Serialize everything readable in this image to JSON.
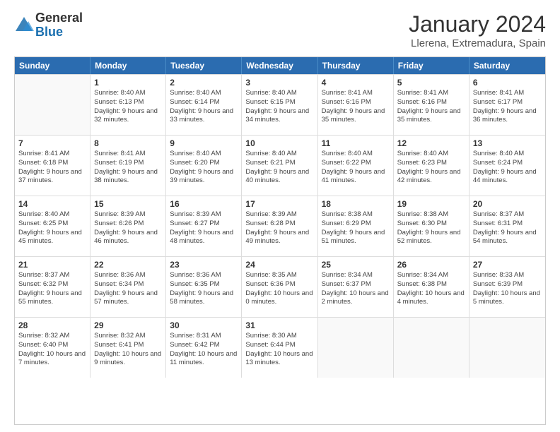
{
  "logo": {
    "general": "General",
    "blue": "Blue"
  },
  "title": "January 2024",
  "location": "Llerena, Extremadura, Spain",
  "header_days": [
    "Sunday",
    "Monday",
    "Tuesday",
    "Wednesday",
    "Thursday",
    "Friday",
    "Saturday"
  ],
  "weeks": [
    [
      {
        "day": "",
        "empty": true
      },
      {
        "day": "1",
        "sunrise": "Sunrise: 8:40 AM",
        "sunset": "Sunset: 6:13 PM",
        "daylight": "Daylight: 9 hours and 32 minutes."
      },
      {
        "day": "2",
        "sunrise": "Sunrise: 8:40 AM",
        "sunset": "Sunset: 6:14 PM",
        "daylight": "Daylight: 9 hours and 33 minutes."
      },
      {
        "day": "3",
        "sunrise": "Sunrise: 8:40 AM",
        "sunset": "Sunset: 6:15 PM",
        "daylight": "Daylight: 9 hours and 34 minutes."
      },
      {
        "day": "4",
        "sunrise": "Sunrise: 8:41 AM",
        "sunset": "Sunset: 6:16 PM",
        "daylight": "Daylight: 9 hours and 35 minutes."
      },
      {
        "day": "5",
        "sunrise": "Sunrise: 8:41 AM",
        "sunset": "Sunset: 6:16 PM",
        "daylight": "Daylight: 9 hours and 35 minutes."
      },
      {
        "day": "6",
        "sunrise": "Sunrise: 8:41 AM",
        "sunset": "Sunset: 6:17 PM",
        "daylight": "Daylight: 9 hours and 36 minutes."
      }
    ],
    [
      {
        "day": "7",
        "sunrise": "Sunrise: 8:41 AM",
        "sunset": "Sunset: 6:18 PM",
        "daylight": "Daylight: 9 hours and 37 minutes."
      },
      {
        "day": "8",
        "sunrise": "Sunrise: 8:41 AM",
        "sunset": "Sunset: 6:19 PM",
        "daylight": "Daylight: 9 hours and 38 minutes."
      },
      {
        "day": "9",
        "sunrise": "Sunrise: 8:40 AM",
        "sunset": "Sunset: 6:20 PM",
        "daylight": "Daylight: 9 hours and 39 minutes."
      },
      {
        "day": "10",
        "sunrise": "Sunrise: 8:40 AM",
        "sunset": "Sunset: 6:21 PM",
        "daylight": "Daylight: 9 hours and 40 minutes."
      },
      {
        "day": "11",
        "sunrise": "Sunrise: 8:40 AM",
        "sunset": "Sunset: 6:22 PM",
        "daylight": "Daylight: 9 hours and 41 minutes."
      },
      {
        "day": "12",
        "sunrise": "Sunrise: 8:40 AM",
        "sunset": "Sunset: 6:23 PM",
        "daylight": "Daylight: 9 hours and 42 minutes."
      },
      {
        "day": "13",
        "sunrise": "Sunrise: 8:40 AM",
        "sunset": "Sunset: 6:24 PM",
        "daylight": "Daylight: 9 hours and 44 minutes."
      }
    ],
    [
      {
        "day": "14",
        "sunrise": "Sunrise: 8:40 AM",
        "sunset": "Sunset: 6:25 PM",
        "daylight": "Daylight: 9 hours and 45 minutes."
      },
      {
        "day": "15",
        "sunrise": "Sunrise: 8:39 AM",
        "sunset": "Sunset: 6:26 PM",
        "daylight": "Daylight: 9 hours and 46 minutes."
      },
      {
        "day": "16",
        "sunrise": "Sunrise: 8:39 AM",
        "sunset": "Sunset: 6:27 PM",
        "daylight": "Daylight: 9 hours and 48 minutes."
      },
      {
        "day": "17",
        "sunrise": "Sunrise: 8:39 AM",
        "sunset": "Sunset: 6:28 PM",
        "daylight": "Daylight: 9 hours and 49 minutes."
      },
      {
        "day": "18",
        "sunrise": "Sunrise: 8:38 AM",
        "sunset": "Sunset: 6:29 PM",
        "daylight": "Daylight: 9 hours and 51 minutes."
      },
      {
        "day": "19",
        "sunrise": "Sunrise: 8:38 AM",
        "sunset": "Sunset: 6:30 PM",
        "daylight": "Daylight: 9 hours and 52 minutes."
      },
      {
        "day": "20",
        "sunrise": "Sunrise: 8:37 AM",
        "sunset": "Sunset: 6:31 PM",
        "daylight": "Daylight: 9 hours and 54 minutes."
      }
    ],
    [
      {
        "day": "21",
        "sunrise": "Sunrise: 8:37 AM",
        "sunset": "Sunset: 6:32 PM",
        "daylight": "Daylight: 9 hours and 55 minutes."
      },
      {
        "day": "22",
        "sunrise": "Sunrise: 8:36 AM",
        "sunset": "Sunset: 6:34 PM",
        "daylight": "Daylight: 9 hours and 57 minutes."
      },
      {
        "day": "23",
        "sunrise": "Sunrise: 8:36 AM",
        "sunset": "Sunset: 6:35 PM",
        "daylight": "Daylight: 9 hours and 58 minutes."
      },
      {
        "day": "24",
        "sunrise": "Sunrise: 8:35 AM",
        "sunset": "Sunset: 6:36 PM",
        "daylight": "Daylight: 10 hours and 0 minutes."
      },
      {
        "day": "25",
        "sunrise": "Sunrise: 8:34 AM",
        "sunset": "Sunset: 6:37 PM",
        "daylight": "Daylight: 10 hours and 2 minutes."
      },
      {
        "day": "26",
        "sunrise": "Sunrise: 8:34 AM",
        "sunset": "Sunset: 6:38 PM",
        "daylight": "Daylight: 10 hours and 4 minutes."
      },
      {
        "day": "27",
        "sunrise": "Sunrise: 8:33 AM",
        "sunset": "Sunset: 6:39 PM",
        "daylight": "Daylight: 10 hours and 5 minutes."
      }
    ],
    [
      {
        "day": "28",
        "sunrise": "Sunrise: 8:32 AM",
        "sunset": "Sunset: 6:40 PM",
        "daylight": "Daylight: 10 hours and 7 minutes."
      },
      {
        "day": "29",
        "sunrise": "Sunrise: 8:32 AM",
        "sunset": "Sunset: 6:41 PM",
        "daylight": "Daylight: 10 hours and 9 minutes."
      },
      {
        "day": "30",
        "sunrise": "Sunrise: 8:31 AM",
        "sunset": "Sunset: 6:42 PM",
        "daylight": "Daylight: 10 hours and 11 minutes."
      },
      {
        "day": "31",
        "sunrise": "Sunrise: 8:30 AM",
        "sunset": "Sunset: 6:44 PM",
        "daylight": "Daylight: 10 hours and 13 minutes."
      },
      {
        "day": "",
        "empty": true
      },
      {
        "day": "",
        "empty": true
      },
      {
        "day": "",
        "empty": true
      }
    ]
  ]
}
